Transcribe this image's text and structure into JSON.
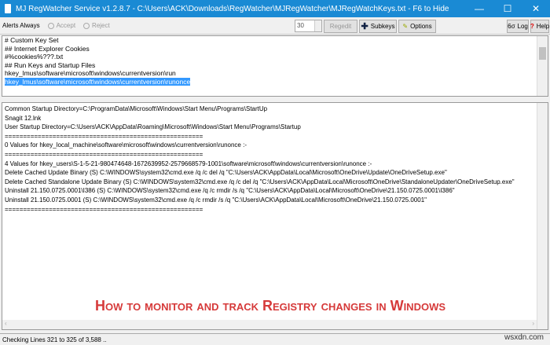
{
  "window": {
    "title": "MJ RegWatcher Service v1.2.8.7 - C:\\Users\\ACK\\Downloads\\RegWatcher\\MJRegWatcher\\MJRegWatchKeys.txt - F6 to Hide",
    "minimize": "—",
    "maximize": "☐",
    "close": "✕"
  },
  "toolbar": {
    "alerts_label": "Alerts Always",
    "accept": "Accept",
    "reject": "Reject",
    "interval": "30",
    "regedit": "Regedit",
    "subkeys": "Subkeys",
    "options": "Options",
    "log": "Log",
    "help": "Help"
  },
  "keys_lines": [
    "# Custom Key Set",
    "## Internet Explorer Cookies",
    "#%cookies%???.txt",
    "## Run Keys and Startup Files",
    "hkey_lmus\\software\\microsoft\\windows\\currentversion\\run"
  ],
  "keys_selected": "hkey_lmus\\software\\microsoft\\windows\\currentversion\\runonce",
  "output_lines": [
    "Common Startup Directory=C:\\ProgramData\\Microsoft\\Windows\\Start Menu\\Programs\\StartUp",
    "Snagit 12.lnk",
    "User Startup Directory=C:\\Users\\ACK\\AppData\\Roaming\\Microsoft\\Windows\\Start Menu\\Programs\\Startup",
    "======================================================",
    "0 Values for hkey_local_machine\\software\\microsoft\\windows\\currentversion\\runonce :-",
    "======================================================",
    "4 Values for hkey_users\\S-1-5-21-980474648-1672639952-2579668579-1001\\software\\microsoft\\windows\\currentversion\\runonce :-",
    "Delete Cached Update Binary (S) C:\\WINDOWS\\system32\\cmd.exe /q /c del /q \"C:\\Users\\ACK\\AppData\\Local\\Microsoft\\OneDrive\\Update\\OneDriveSetup.exe\"",
    "Delete Cached Standalone Update Binary (S) C:\\WINDOWS\\system32\\cmd.exe /q /c del /q \"C:\\Users\\ACK\\AppData\\Local\\Microsoft\\OneDrive\\StandaloneUpdater\\OneDriveSetup.exe\"",
    "Uninstall 21.150.0725.0001\\I386 (S) C:\\WINDOWS\\system32\\cmd.exe /q /c rmdir /s /q \"C:\\Users\\ACK\\AppData\\Local\\Microsoft\\OneDrive\\21.150.0725.0001\\I386\"",
    "Uninstall 21.150.0725.0001 (S) C:\\WINDOWS\\system32\\cmd.exe /q /c rmdir /s /q \"C:\\Users\\ACK\\AppData\\Local\\Microsoft\\OneDrive\\21.150.0725.0001\"",
    "======================================================"
  ],
  "banner": "How to monitor and track Registry changes in Windows",
  "status": "Checking Lines 321 to 325 of 3,588 ..",
  "watermark": "wsxdn.com"
}
